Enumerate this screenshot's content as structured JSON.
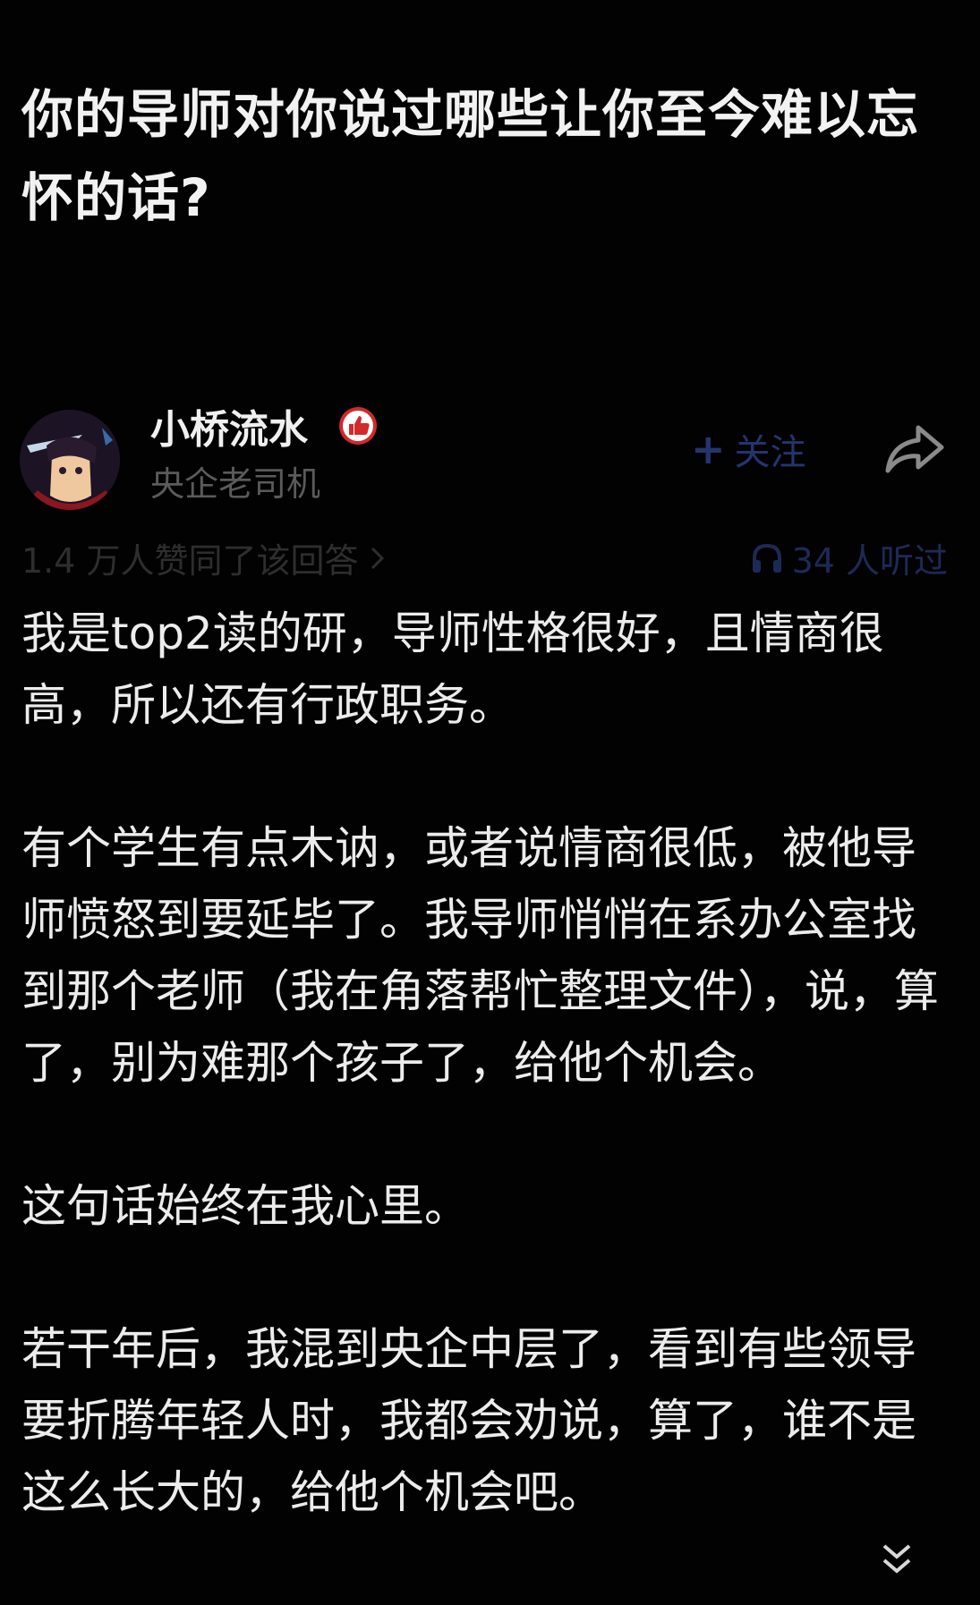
{
  "question": {
    "title": "你的导师对你说过哪些让你至今难以忘怀的话?"
  },
  "author": {
    "name": "小桥流水",
    "bio": "央企老司机",
    "badge_icon": "thumbs-up-badge-icon",
    "follow_label": "关注",
    "share_icon": "share-arrow-icon"
  },
  "meta": {
    "likes_text": "1.4 万人赞同了该回答",
    "listeners_text": "34 人听过"
  },
  "answer": {
    "paragraphs": [
      "我是top2读的研，导师性格很好，且情商很高，所以还有行政职务。",
      "有个学生有点木讷，或者说情商很低，被他导师愤怒到要延毕了。我导师悄悄在系办公室找到那个老师（我在角落帮忙整理文件），说，算了，别为难那个孩子了，给他个机会。",
      "这句话始终在我心里。",
      "若干年后，我混到央企中层了，看到有些领导要折腾年轻人时，我都会劝说，算了，谁不是这么长大的，给他个机会吧。"
    ]
  },
  "colors": {
    "background": "#020203",
    "accent_blue": "#24346e",
    "muted_gray": "#5a5a5a"
  }
}
